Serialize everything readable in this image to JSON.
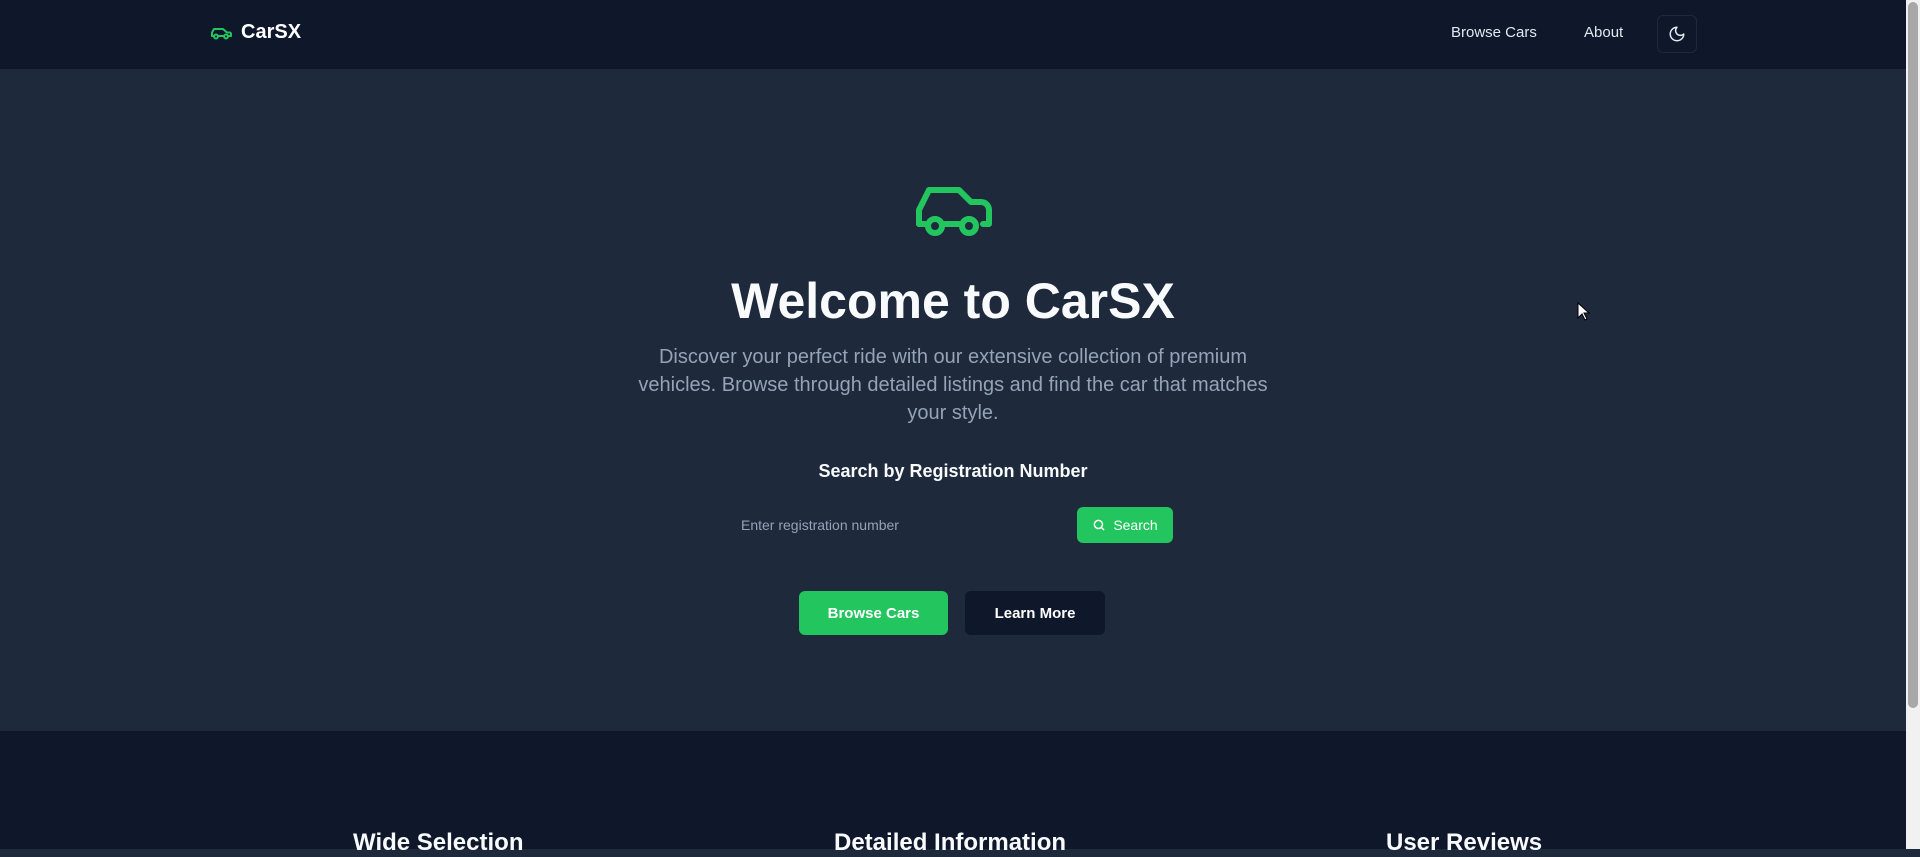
{
  "header": {
    "brand": "CarSX",
    "nav": [
      "Browse Cars",
      "About"
    ],
    "theme_toggle_icon": "moon-icon",
    "logo_icon": "car-icon"
  },
  "hero": {
    "icon": "car-icon",
    "title": "Welcome to CarSX",
    "subtitle": "Discover your perfect ride with our extensive collection of premium vehicles. Browse through detailed listings and find the car that matches your style.",
    "search_heading": "Search by Registration Number",
    "search_placeholder": "Enter registration number",
    "search_value": "",
    "search_button": "Search",
    "primary_button": "Browse Cars",
    "secondary_button": "Learn More"
  },
  "features": [
    {
      "title": "Wide Selection"
    },
    {
      "title": "Detailed Information"
    },
    {
      "title": "User Reviews"
    }
  ],
  "colors": {
    "accent": "#22c55e",
    "nav_bg": "#0f172a",
    "hero_bg": "#1e293b",
    "muted_text": "#94a3b8"
  }
}
